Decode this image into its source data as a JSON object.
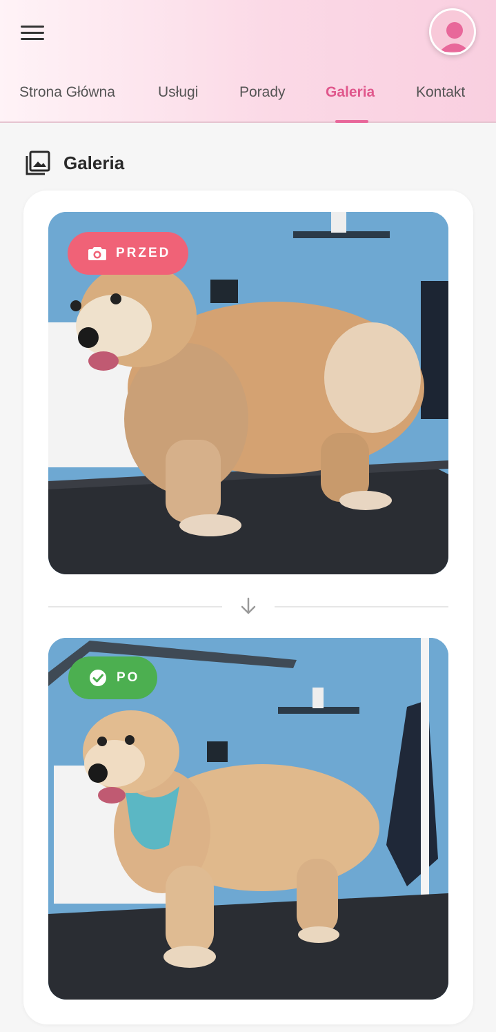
{
  "header": {
    "nav": [
      "Strona Główna",
      "Usługi",
      "Porady",
      "Galeria",
      "Kontakt"
    ],
    "active_tab": "Galeria",
    "accent_color": "#e0578c"
  },
  "section": {
    "title": "Galeria",
    "icon": "gallery-icon"
  },
  "gallery": {
    "before_label": "PRZED",
    "after_label": "PO",
    "before_color": "#f06277",
    "after_color": "#4caf50",
    "before_icon": "camera-icon",
    "after_icon": "check-circle-icon",
    "separator_icon": "arrow-down-icon"
  }
}
